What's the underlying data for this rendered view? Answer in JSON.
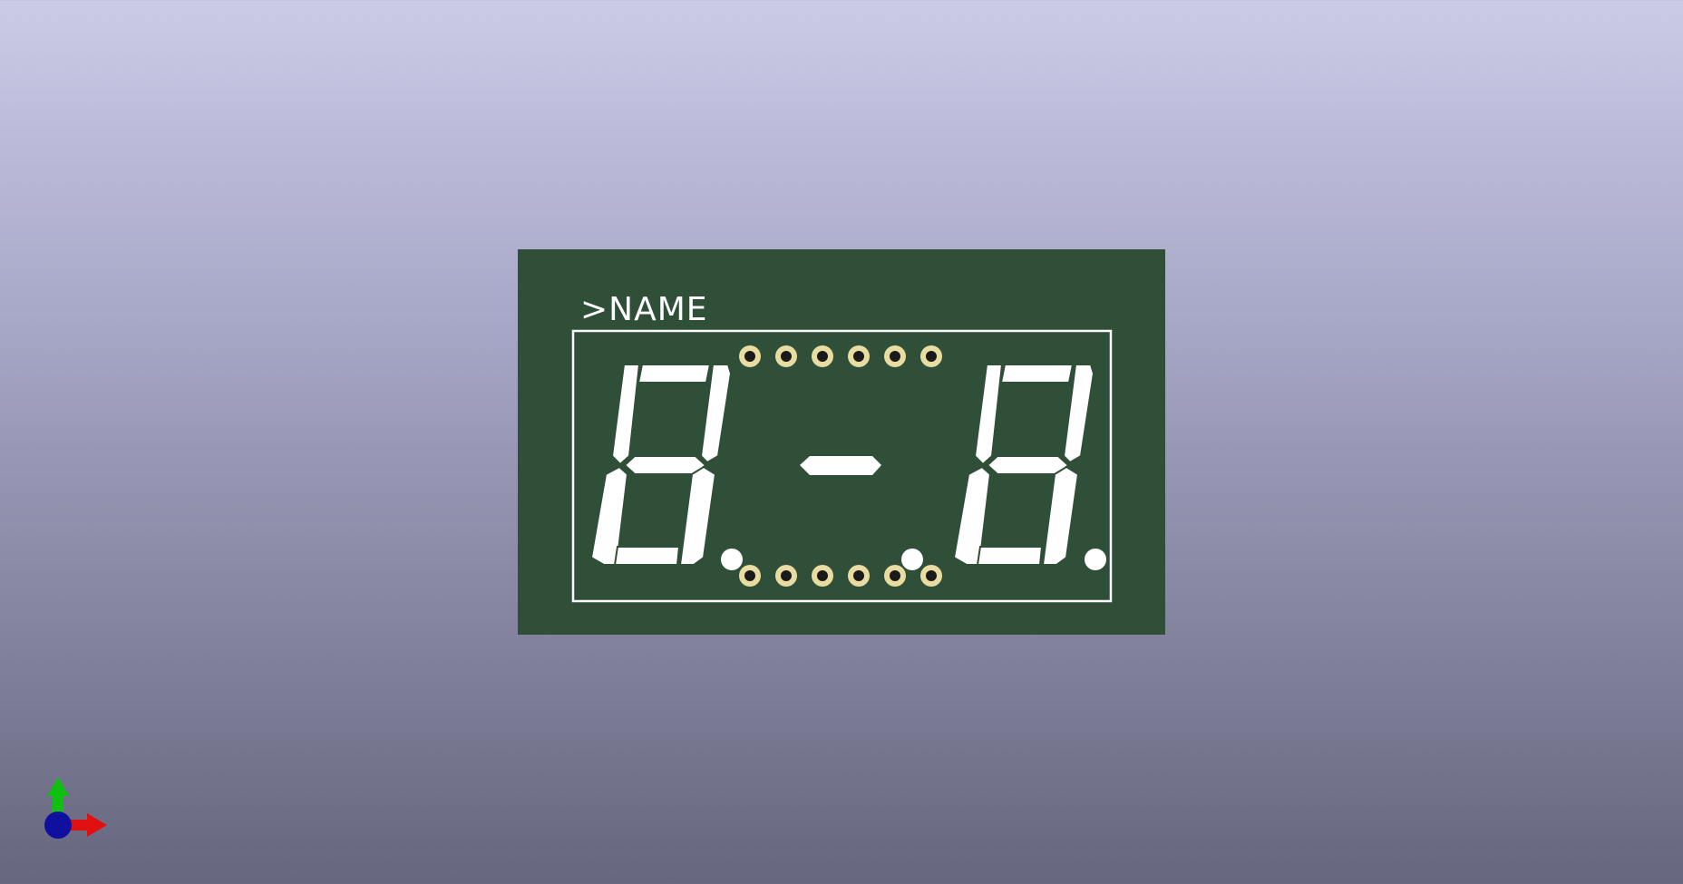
{
  "viewer": {
    "board": {
      "silkscreen_label": ">NAME",
      "colors": {
        "pcb": "#2f4f38",
        "silkscreen": "#ffffff",
        "pad_copper": "#e8dca0",
        "pad_hole": "#1a1a1a"
      },
      "pin_count_per_row": 6,
      "display_text": "8.-8."
    },
    "axis_gizmo": {
      "icons": [
        "y-axis-arrow-icon",
        "x-axis-arrow-icon",
        "z-axis-origin-icon"
      ],
      "colors": {
        "x": "#e01010",
        "y": "#10c010",
        "z": "#1010a0"
      }
    }
  }
}
